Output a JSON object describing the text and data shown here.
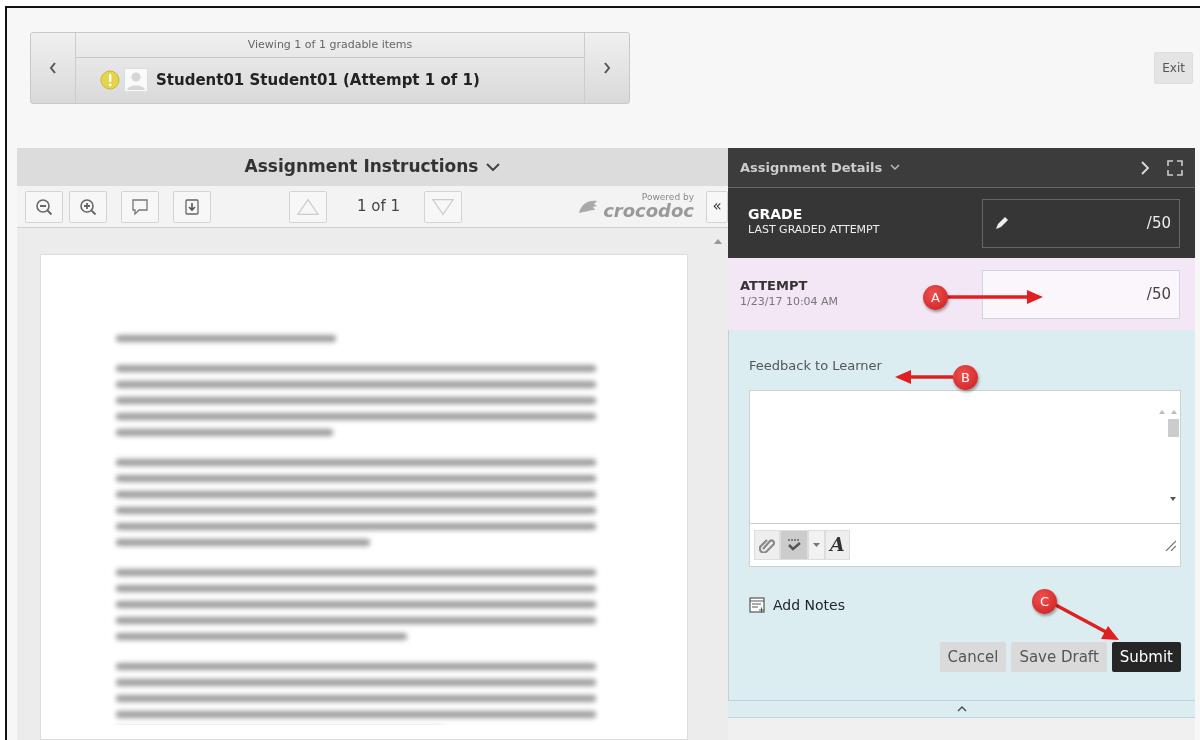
{
  "header": {
    "nav_caption": "Viewing 1 of 1 gradable items",
    "student": "Student01 Student01 (Attempt 1 of 1)",
    "exit_button": "Exit"
  },
  "instructions_panel": {
    "title": "Assignment Instructions",
    "page_indicator": "1 of 1",
    "powered_by": "Powered by",
    "brand": "crocodoc",
    "collapse_button": "«"
  },
  "details_panel": {
    "title": "Assignment Details",
    "grade": {
      "label": "GRADE",
      "sublabel": "LAST GRADED ATTEMPT",
      "out_of": "/50"
    },
    "attempt": {
      "label": "ATTEMPT",
      "date": "1/23/17 10:04 AM",
      "out_of": "/50"
    },
    "feedback": {
      "label": "Feedback to Learner",
      "font_button": "A"
    },
    "add_notes": "Add Notes",
    "buttons": [
      {
        "label": "Cancel",
        "kind": "secondary"
      },
      {
        "label": "Save Draft",
        "kind": "secondary"
      },
      {
        "label": "Submit",
        "kind": "primary"
      }
    ]
  },
  "annotations": [
    {
      "letter": "A"
    },
    {
      "letter": "B"
    },
    {
      "letter": "C"
    }
  ]
}
